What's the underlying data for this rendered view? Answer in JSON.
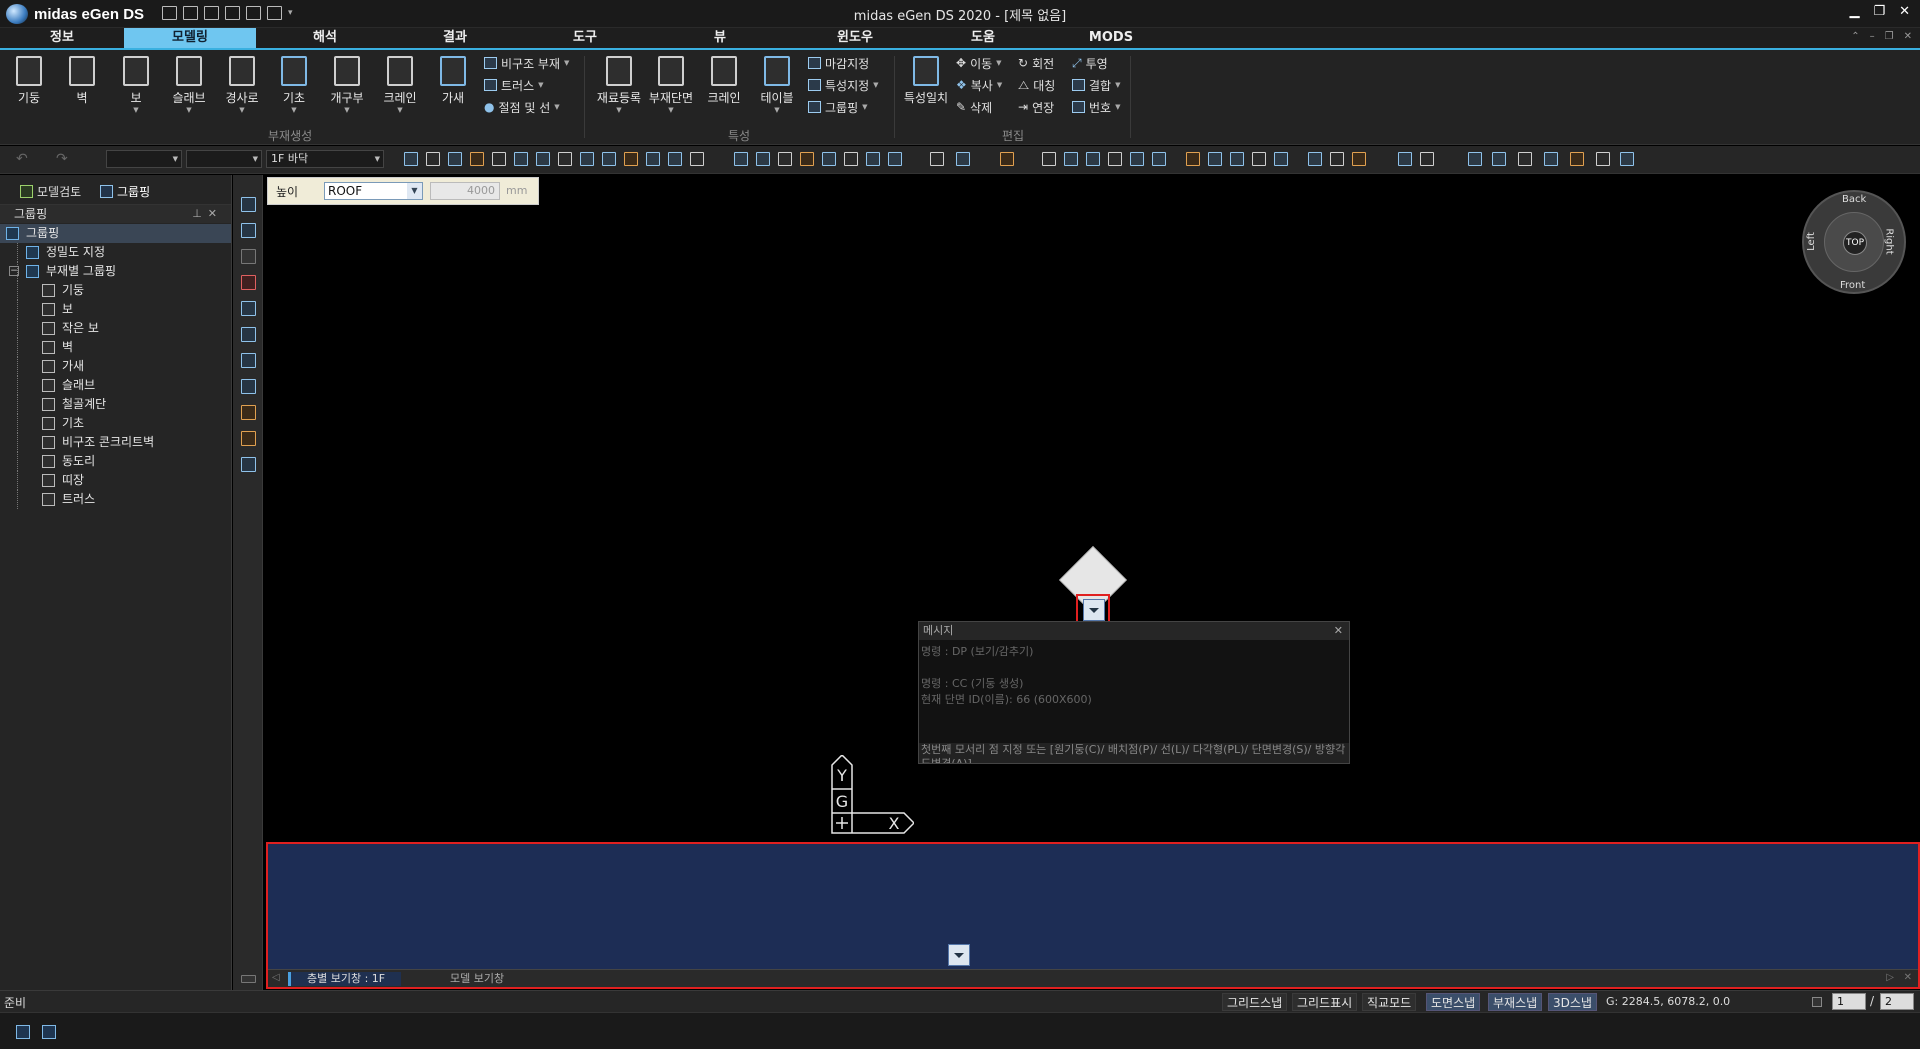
{
  "app": {
    "logo_text": "midas eGen DS",
    "window_title": "midas eGen DS 2020 - [제목 없음]",
    "window_buttons": [
      "minimize",
      "restore",
      "close"
    ]
  },
  "menu": {
    "tabs": [
      "정보",
      "모델링",
      "해석",
      "결과",
      "도구",
      "뷰",
      "윈도우",
      "도움",
      "MODS"
    ],
    "active": "모델링"
  },
  "ribbon": {
    "group1": {
      "label": "부재생성",
      "buttons": [
        "기둥",
        "벽",
        "보",
        "슬래브",
        "경사로",
        "기초",
        "개구부",
        "크레인",
        "가새"
      ],
      "small": [
        "비구조 부재",
        "트러스",
        "절점 및 선"
      ]
    },
    "group2": {
      "label": "특성",
      "buttons": [
        "재료등록",
        "부재단면",
        "크레인",
        "테이블"
      ],
      "small": [
        "마감지정",
        "특성지정",
        "그룹핑"
      ]
    },
    "group3": {
      "label": "편집",
      "buttons": [
        "특성일치"
      ],
      "small": [
        "이동",
        "회전",
        "투영",
        "복사",
        "대칭",
        "결합",
        "삭제",
        "연장",
        "번호"
      ]
    }
  },
  "toolbar2": {
    "combo1": "",
    "combo2": "",
    "floor_combo": "1F 바닥"
  },
  "left_panel": {
    "tabs": [
      "모델검토",
      "그룹핑"
    ],
    "active_tab": "그룹핑",
    "header": "그룹핑",
    "tree": [
      {
        "label": "그룹핑",
        "level": 0,
        "selected": true
      },
      {
        "label": "정밀도 지정",
        "level": 1
      },
      {
        "label": "부재별 그룹핑",
        "level": 1,
        "expanded": true
      },
      {
        "label": "기둥",
        "level": 2
      },
      {
        "label": "보",
        "level": 2
      },
      {
        "label": "작은 보",
        "level": 2
      },
      {
        "label": "벽",
        "level": 2
      },
      {
        "label": "가새",
        "level": 2
      },
      {
        "label": "슬래브",
        "level": 2
      },
      {
        "label": "철골계단",
        "level": 2
      },
      {
        "label": "기초",
        "level": 2
      },
      {
        "label": "비구조 콘크리트벽",
        "level": 2
      },
      {
        "label": "동도리",
        "level": 2
      },
      {
        "label": "띠장",
        "level": 2
      },
      {
        "label": "트러스",
        "level": 2
      }
    ]
  },
  "height_bar": {
    "label": "높이",
    "select_value": "ROOF",
    "value": "4000",
    "unit": "mm"
  },
  "view_cube": {
    "center": "TOP",
    "back": "Back",
    "front": "Front",
    "left": "Left",
    "right": "Right"
  },
  "message_window": {
    "title": "메시지",
    "lines": [
      "명령 : DP (보기/감추기)",
      "",
      "명령 : CC (기둥 생성)",
      "현재 단면 ID(이름): 66 (600X600)"
    ],
    "prompt": "첫번째 모서리 점 지정 또는 [원기둥(C)/ 배치점(P)/ 선(L)/ 다각형(PL)/ 단면변경(S)/ 방향각도변경(A)]"
  },
  "ucs": {
    "y": "Y",
    "g": "G",
    "x": "X"
  },
  "bottom_panel": {
    "tabs": [
      "층별 보기창 : 1F",
      "모델 보기창"
    ],
    "active_tab": "층별 보기창 : 1F"
  },
  "status": {
    "ready": "준비",
    "snaps": [
      "그리드스냅",
      "그리드표시",
      "직교모드",
      "도면스냅",
      "부재스냅",
      "3D스냅"
    ],
    "snaps_on": [
      "도면스냅",
      "부재스냅",
      "3D스냅"
    ],
    "coord": "G: 2284.5, 6078.2, 0.0",
    "page_current": "1",
    "page_total": "2",
    "page_separator": "/"
  }
}
